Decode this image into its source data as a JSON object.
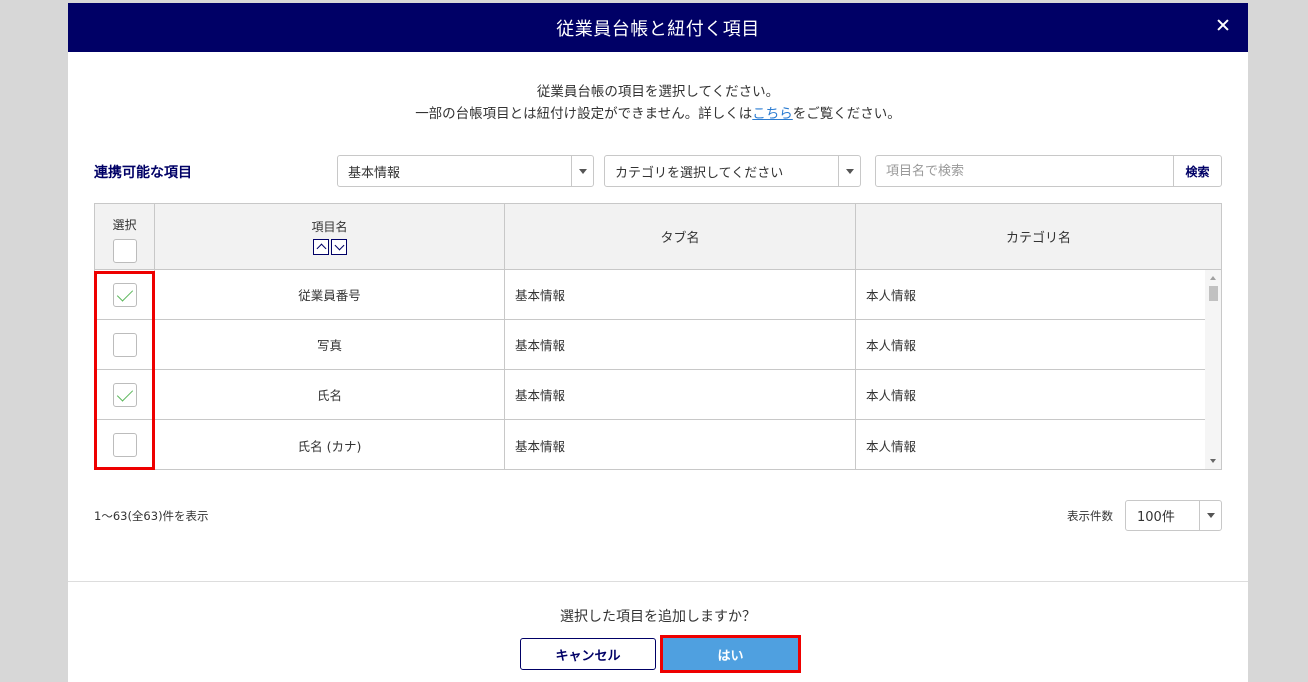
{
  "modal": {
    "title": "従業員台帳と紐付く項目",
    "description_line1": "従業員台帳の項目を選択してください。",
    "description_line2_before": "一部の台帳項目とは紐付け設定ができません。詳しくは",
    "description_link": "こちら",
    "description_line2_after": "をご覧ください。"
  },
  "filters": {
    "label": "連携可能な項目",
    "tab_select_value": "基本情報",
    "category_select_value": "カテゴリを選択してください",
    "search_placeholder": "項目名で検索",
    "search_button": "検索"
  },
  "table": {
    "headers": {
      "select": "選択",
      "name": "項目名",
      "tab": "タブ名",
      "category": "カテゴリ名"
    },
    "rows": [
      {
        "checked": true,
        "name": "従業員番号",
        "tab": "基本情報",
        "category": "本人情報"
      },
      {
        "checked": false,
        "name": "写真",
        "tab": "基本情報",
        "category": "本人情報"
      },
      {
        "checked": true,
        "name": "氏名",
        "tab": "基本情報",
        "category": "本人情報"
      },
      {
        "checked": false,
        "name": "氏名 (カナ)",
        "tab": "基本情報",
        "category": "本人情報"
      }
    ]
  },
  "pagination": {
    "count_text": "1〜63(全63)件を表示",
    "per_page_label": "表示件数",
    "per_page_value": "100件"
  },
  "footer": {
    "confirm_text": "選択した項目を追加しますか？",
    "cancel_button": "キャンセル",
    "yes_button": "はい"
  },
  "colors": {
    "header_bg": "#000066",
    "primary_button": "#4fa0e0",
    "highlight": "#e00000",
    "check": "#5cb85c"
  }
}
